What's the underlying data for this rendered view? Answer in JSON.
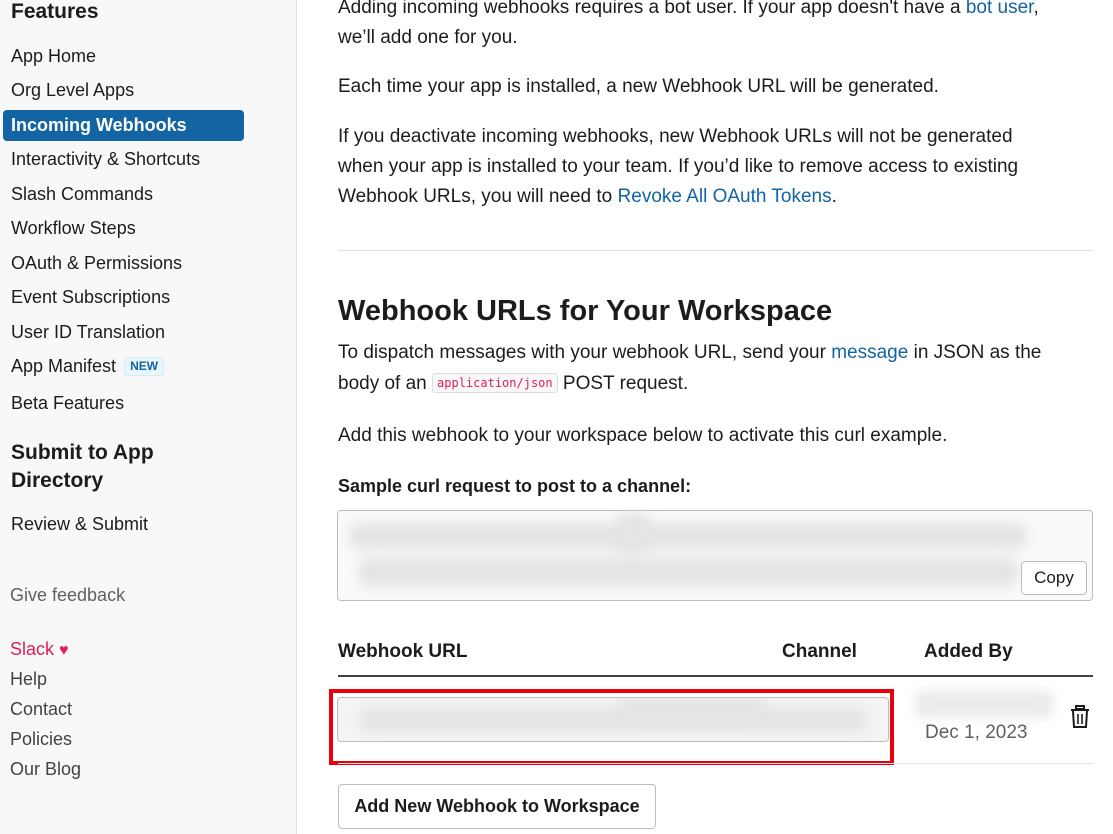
{
  "sidebar": {
    "features_heading": "Features",
    "items": [
      {
        "label": "App Home"
      },
      {
        "label": "Org Level Apps"
      },
      {
        "label": "Incoming Webhooks",
        "active": true
      },
      {
        "label": "Interactivity & Shortcuts"
      },
      {
        "label": "Slash Commands"
      },
      {
        "label": "Workflow Steps"
      },
      {
        "label": "OAuth & Permissions"
      },
      {
        "label": "Event Subscriptions"
      },
      {
        "label": "User ID Translation"
      },
      {
        "label": "App Manifest",
        "badge": "NEW"
      },
      {
        "label": "Beta Features"
      }
    ],
    "submit_heading_line1": "Submit to App",
    "submit_heading_line2": "Directory",
    "review_submit": "Review & Submit",
    "give_feedback": "Give feedback",
    "footer": {
      "slack": "Slack",
      "help": "Help",
      "contact": "Contact",
      "policies": "Policies",
      "blog": "Our Blog"
    }
  },
  "main": {
    "intro_text": "Adding incoming webhooks requires a bot user. If your app doesn't have a ",
    "intro_link": "bot user",
    "intro_text2": ",",
    "intro_line2": "we’ll add one for you.",
    "new_url_text": "Each time your app is installed, a new Webhook URL will be generated.",
    "deactivate_text": "If you deactivate incoming webhooks, new Webhook URLs will not be generated when your app is installed to your team. If you’d like to remove access to existing Webhook URLs, you will need to ",
    "revoke_link": "Revoke All OAuth Tokens",
    "revoke_end": ".",
    "section_title": "Webhook URLs for Your Workspace",
    "dispatch_text1": "To dispatch messages with your webhook URL, send your ",
    "dispatch_link": "message",
    "dispatch_text2": " in JSON as the body of an ",
    "dispatch_code": "application/json",
    "dispatch_text3": " POST request.",
    "add_to_activate": "Add this webhook to your workspace below to activate this curl example.",
    "sample_label": "Sample curl request to post to a channel:",
    "copy_button": "Copy",
    "table": {
      "headers": [
        "Webhook URL",
        "Channel",
        "Added By"
      ],
      "rows": [
        {
          "added_date": "Dec 1, 2023"
        }
      ]
    },
    "add_webhook_button": "Add New Webhook to Workspace"
  },
  "colors": {
    "accent": "#1264a3",
    "highlight_box": "#e8000b",
    "slack_pink": "#e01e5a"
  }
}
